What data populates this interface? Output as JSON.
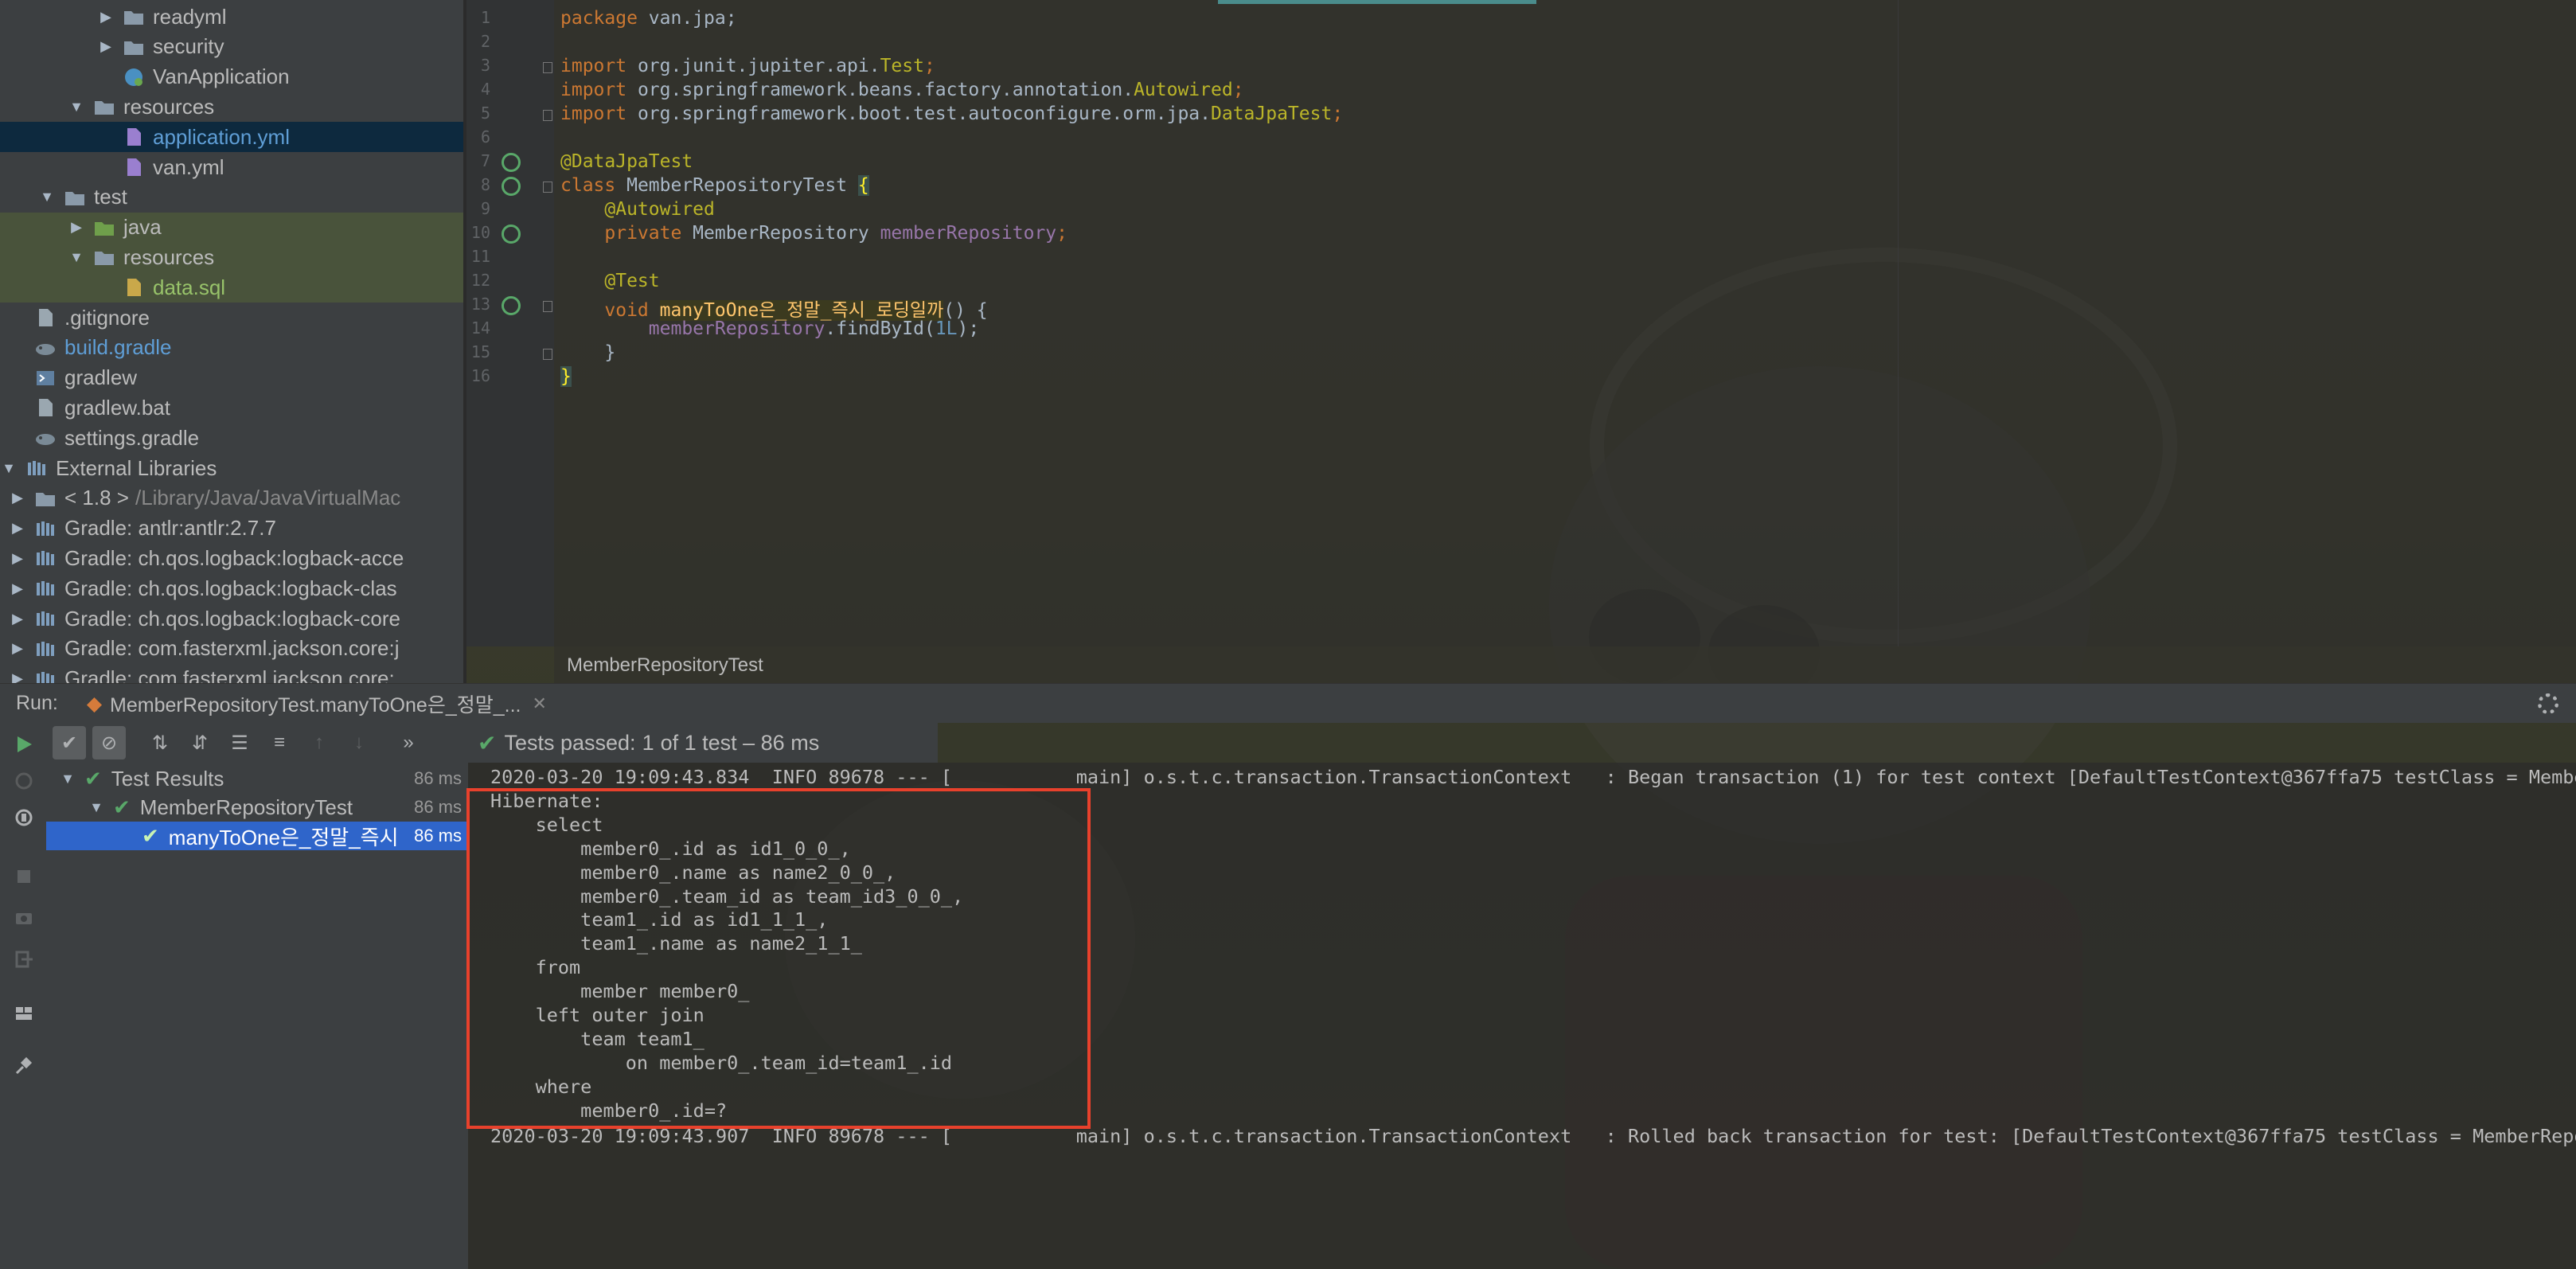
{
  "project_tree": [
    {
      "indent": 2,
      "arrow": "right",
      "icon": "folder",
      "label": "readyml"
    },
    {
      "indent": 2,
      "arrow": "right",
      "icon": "folder",
      "label": "security"
    },
    {
      "indent": 2,
      "arrow": "",
      "icon": "spring-class",
      "label": "VanApplication"
    },
    {
      "indent": 1,
      "arrow": "down",
      "icon": "folder-res",
      "label": "resources"
    },
    {
      "indent": 2,
      "arrow": "",
      "icon": "yml",
      "label": "application.yml",
      "style": "blue",
      "selected": true
    },
    {
      "indent": 2,
      "arrow": "",
      "icon": "yml",
      "label": "van.yml"
    },
    {
      "indent": 0,
      "arrow": "down",
      "icon": "folder",
      "label": "test"
    },
    {
      "indent": 1,
      "arrow": "right",
      "icon": "folder-green",
      "label": "java",
      "green": true
    },
    {
      "indent": 1,
      "arrow": "down",
      "icon": "folder-res",
      "label": "resources",
      "green": true
    },
    {
      "indent": 2,
      "arrow": "",
      "icon": "sql",
      "label": "data.sql",
      "style": "green",
      "green": true
    },
    {
      "indent": -1,
      "arrow": "",
      "icon": "file",
      "label": ".gitignore"
    },
    {
      "indent": -1,
      "arrow": "",
      "icon": "gradle",
      "label": "build.gradle",
      "style": "blue"
    },
    {
      "indent": -1,
      "arrow": "",
      "icon": "terminal",
      "label": "gradlew"
    },
    {
      "indent": -1,
      "arrow": "",
      "icon": "file",
      "label": "gradlew.bat"
    },
    {
      "indent": -1,
      "arrow": "",
      "icon": "gradle",
      "label": "settings.gradle"
    },
    {
      "indent": -2,
      "arrow": "down",
      "icon": "library",
      "label": "External Libraries"
    },
    {
      "indent": -1,
      "arrow": "right",
      "icon": "folder",
      "label": "< 1.8 >",
      "suffix": "/Library/Java/JavaVirtualMac"
    },
    {
      "indent": -1,
      "arrow": "right",
      "icon": "library",
      "label": "Gradle: antlr:antlr:2.7.7"
    },
    {
      "indent": -1,
      "arrow": "right",
      "icon": "library",
      "label": "Gradle: ch.qos.logback:logback-acce"
    },
    {
      "indent": -1,
      "arrow": "right",
      "icon": "library",
      "label": "Gradle: ch.qos.logback:logback-clas"
    },
    {
      "indent": -1,
      "arrow": "right",
      "icon": "library",
      "label": "Gradle: ch.qos.logback:logback-core"
    },
    {
      "indent": -1,
      "arrow": "right",
      "icon": "library",
      "label": "Gradle: com.fasterxml.jackson.core:j"
    },
    {
      "indent": -1,
      "arrow": "right",
      "icon": "library",
      "label": "Gradle: com.fasterxml.jackson.core:"
    }
  ],
  "editor": {
    "line_numbers": [
      "1",
      "2",
      "3",
      "4",
      "5",
      "6",
      "7",
      "8",
      "9",
      "10",
      "11",
      "12",
      "13",
      "14",
      "15",
      "16"
    ],
    "code": [
      [
        [
          "kw",
          "package "
        ],
        [
          "",
          "van.jpa;"
        ]
      ],
      [],
      [
        [
          "kw",
          "import "
        ],
        [
          "",
          "org.junit.jupiter.api."
        ],
        [
          "ann",
          "Test"
        ],
        [
          "kw",
          ";"
        ]
      ],
      [
        [
          "kw",
          "import "
        ],
        [
          "",
          "org.springframework.beans.factory.annotation."
        ],
        [
          "ann",
          "Autowired"
        ],
        [
          "kw",
          ";"
        ]
      ],
      [
        [
          "kw",
          "import "
        ],
        [
          "",
          "org.springframework.boot.test.autoconfigure.orm.jpa."
        ],
        [
          "ann",
          "DataJpaTest"
        ],
        [
          "kw",
          ";"
        ]
      ],
      [],
      [
        [
          "ann",
          "@DataJpaTest"
        ]
      ],
      [
        [
          "kw",
          "class "
        ],
        [
          "",
          "MemberRepositoryTest "
        ],
        [
          "brace",
          "{"
        ]
      ],
      [
        [
          "",
          "    "
        ],
        [
          "ann",
          "@Autowired"
        ]
      ],
      [
        [
          "",
          "    "
        ],
        [
          "kw",
          "private "
        ],
        [
          "",
          "MemberRepository "
        ],
        [
          "fld",
          "memberRepository"
        ],
        [
          "kw",
          ";"
        ]
      ],
      [],
      [
        [
          "",
          "    "
        ],
        [
          "ann",
          "@Test"
        ]
      ],
      [
        [
          "",
          "    "
        ],
        [
          "kw",
          "void "
        ],
        [
          "mth",
          "manyToOne은_정말_즉시_로딩일까"
        ],
        [
          "",
          "() {"
        ]
      ],
      [
        [
          "",
          "        "
        ],
        [
          "fld",
          "memberRepository"
        ],
        [
          "",
          ".findById("
        ],
        [
          "num",
          "1L"
        ],
        [
          "",
          "); "
        ]
      ],
      [
        [
          "",
          "    }"
        ]
      ],
      [
        [
          "brace",
          "}"
        ]
      ]
    ],
    "footer_label": "MemberRepositoryTest"
  },
  "run_panel": {
    "run_label": "Run:",
    "tab_label": "MemberRepositoryTest.manyToOne은_정말_...",
    "status_prefix": "Tests passed:",
    "status_count": "1",
    "status_suffix": "of 1 test – 86 ms",
    "results": [
      {
        "label": "Test Results",
        "time": "86 ms",
        "indent": 0
      },
      {
        "label": "MemberRepositoryTest",
        "time": "86 ms",
        "indent": 1
      },
      {
        "label": "manyToOne은_정말_즉시",
        "time": "86 ms",
        "indent": 2,
        "selected": true
      }
    ]
  },
  "console": [
    "2020-03-20 19:09:43.834  INFO 89678 --- [           main] o.s.t.c.transaction.TransactionContext   : Began transaction (1) for test context [DefaultTestContext@367ffa75 testClass = Membe",
    "Hibernate: ",
    "    select",
    "        member0_.id as id1_0_0_,",
    "        member0_.name as name2_0_0_,",
    "        member0_.team_id as team_id3_0_0_,",
    "        team1_.id as id1_1_1_,",
    "        team1_.name as name2_1_1_ ",
    "    from",
    "        member member0_ ",
    "    left outer join",
    "        team team1_ ",
    "            on member0_.team_id=team1_.id ",
    "    where",
    "        member0_.id=?",
    "2020-03-20 19:09:43.907  INFO 89678 --- [           main] o.s.t.c.transaction.TransactionContext   : Rolled back transaction for test: [DefaultTestContext@367ffa75 testClass = MemberRepos"
  ]
}
